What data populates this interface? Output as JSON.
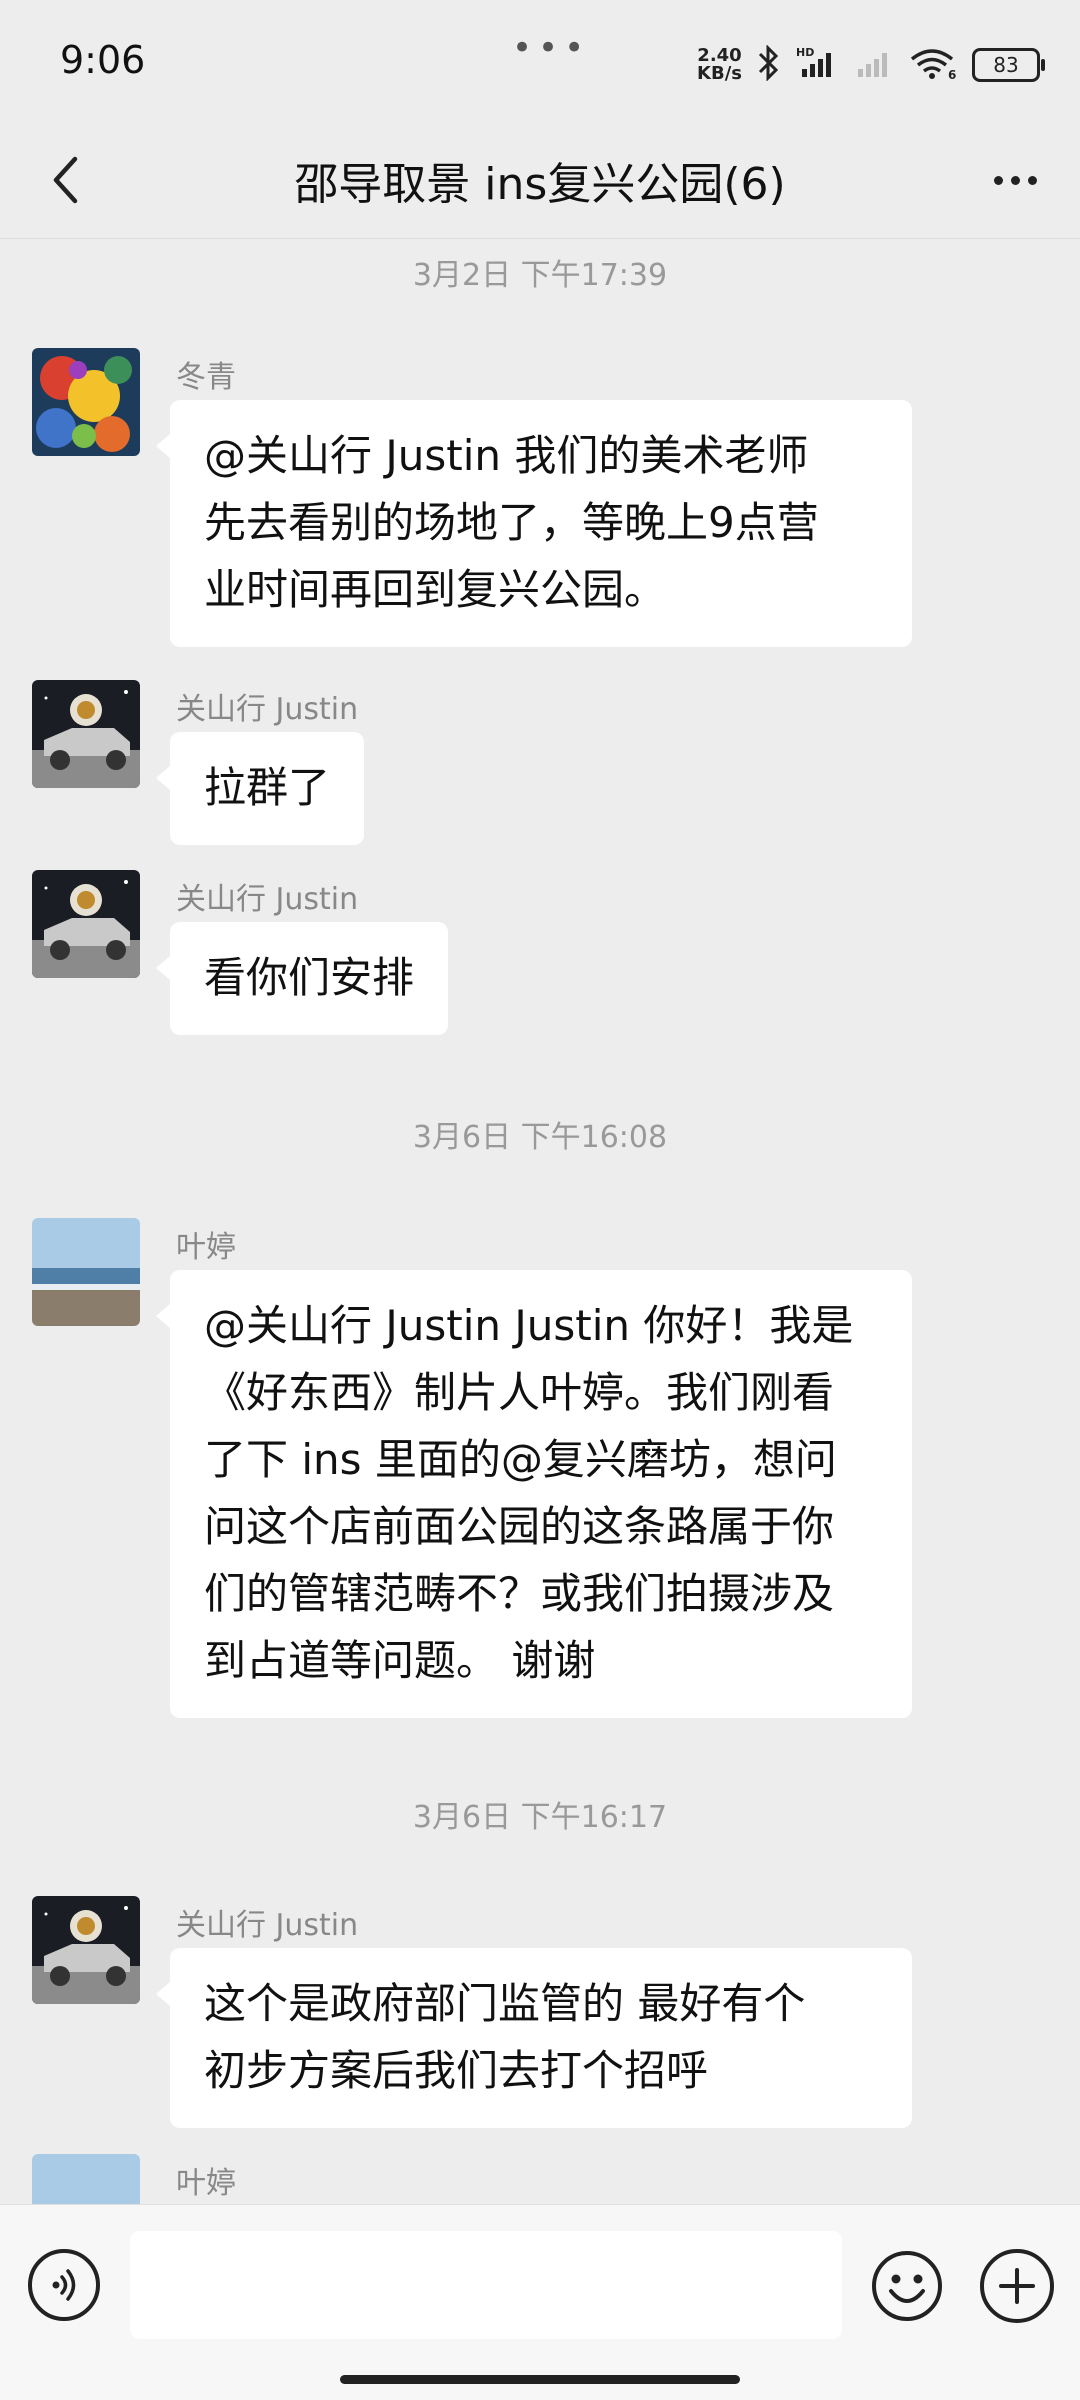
{
  "status_bar": {
    "time": "9:06",
    "net_speed_value": "2.40",
    "net_speed_unit": "KB/s",
    "battery": "83",
    "icons": [
      "bluetooth-icon",
      "hd-signal-icon",
      "signal-icon",
      "wifi-6-icon",
      "battery-icon"
    ]
  },
  "header": {
    "title": "邵导取景 ins复兴公园(6)",
    "back_icon": "chevron-left-icon",
    "more_icon": "more-dots-icon"
  },
  "timestamps": [
    "3月2日 下午17:39",
    "3月6日 下午16:08",
    "3月6日 下午16:17"
  ],
  "messages": [
    {
      "sender": "冬青",
      "avatar": "colorful-abstract-avatar",
      "lines": [
        "@关山行 Justin  我们的美术老师",
        "先去看别的场地了，等晚上9点营",
        "业时间再回到复兴公园。"
      ]
    },
    {
      "sender": "关山行 Justin",
      "avatar": "astronaut-car-avatar",
      "lines": [
        "拉群了"
      ]
    },
    {
      "sender": "关山行 Justin",
      "avatar": "astronaut-car-avatar",
      "lines": [
        "看你们安排"
      ]
    },
    {
      "sender": "叶婷",
      "avatar": "sea-beach-avatar",
      "lines": [
        "@关山行 Justin Justin 你好！我是",
        "《好东西》制片人叶婷。我们刚看",
        "了下 ins 里面的@复兴磨坊，想问",
        "问这个店前面公园的这条路属于你",
        "们的管辖范畴不？或我们拍摄涉及",
        "到占道等问题。 谢谢"
      ]
    },
    {
      "sender": "关山行 Justin",
      "avatar": "astronaut-car-avatar",
      "lines": [
        "这个是政府部门监管的 最好有个",
        "初步方案后我们去打个招呼"
      ]
    },
    {
      "sender": "叶婷",
      "avatar": "sea-beach-avatar",
      "lines": []
    }
  ],
  "input_bar": {
    "placeholder": "",
    "voice_icon": "voice-icon",
    "emoji_icon": "emoji-icon",
    "plus_icon": "plus-icon"
  }
}
